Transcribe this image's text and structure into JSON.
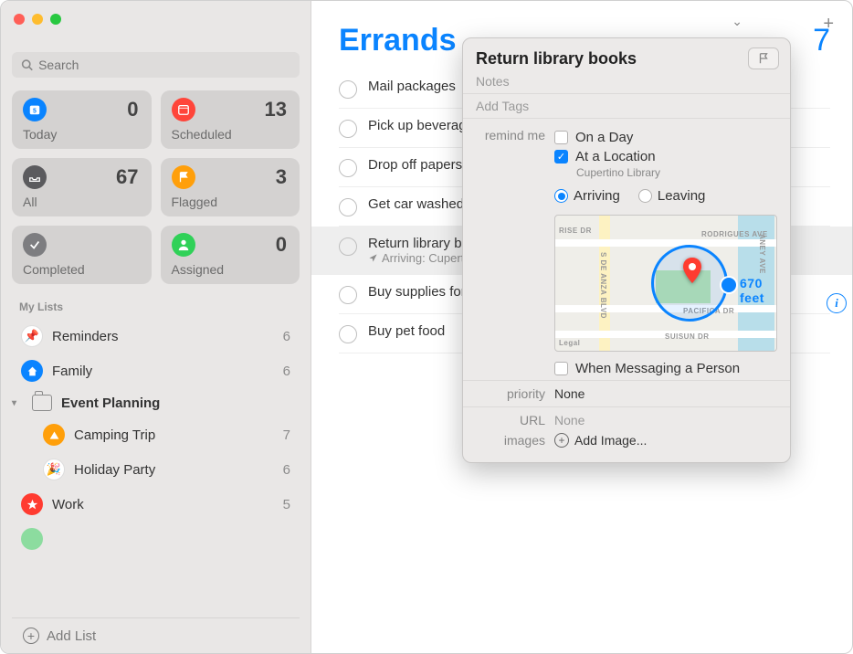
{
  "window": {
    "search_placeholder": "Search"
  },
  "smartLists": {
    "today": {
      "label": "Today",
      "count": "0"
    },
    "scheduled": {
      "label": "Scheduled",
      "count": "13"
    },
    "all": {
      "label": "All",
      "count": "67"
    },
    "flagged": {
      "label": "Flagged",
      "count": "3"
    },
    "completed": {
      "label": "Completed",
      "count": ""
    },
    "assigned": {
      "label": "Assigned",
      "count": "0"
    }
  },
  "sidebar": {
    "section": "My Lists",
    "reminders": {
      "label": "Reminders",
      "count": "6"
    },
    "family": {
      "label": "Family",
      "count": "6"
    },
    "folder": {
      "label": "Event Planning"
    },
    "camping": {
      "label": "Camping Trip",
      "count": "7"
    },
    "holiday": {
      "label": "Holiday Party",
      "count": "6"
    },
    "work": {
      "label": "Work",
      "count": "5"
    },
    "addList": "Add List"
  },
  "list": {
    "title": "Errands",
    "count": "7",
    "items": [
      {
        "title": "Mail packages"
      },
      {
        "title": "Pick up beverages"
      },
      {
        "title": "Drop off papers"
      },
      {
        "title": "Get car washed"
      },
      {
        "title": "Return library books",
        "sub": "Arriving: Cupertino Library"
      },
      {
        "title": "Buy supplies for party"
      },
      {
        "title": "Buy pet food"
      }
    ]
  },
  "popover": {
    "title": "Return library books",
    "notesPlaceholder": "Notes",
    "tagsPlaceholder": "Add Tags",
    "remindLabel": "remind me",
    "onDay": "On a Day",
    "atLocation": "At a Location",
    "locationName": "Cupertino Library",
    "arriving": "Arriving",
    "leaving": "Leaving",
    "distance": "670 feet",
    "whenMessaging": "When Messaging a Person",
    "priorityLabel": "priority",
    "priorityValue": "None",
    "urlLabel": "URL",
    "urlValue": "None",
    "imagesLabel": "images",
    "imagesValue": "Add Image...",
    "map": {
      "streets": [
        "RISE DR",
        "S DE ANZA BLVD",
        "RODRIGUES AVE",
        "PACIFICA DR",
        "SUISUN DR",
        "ANEY AVE"
      ],
      "legal": "Legal"
    }
  }
}
